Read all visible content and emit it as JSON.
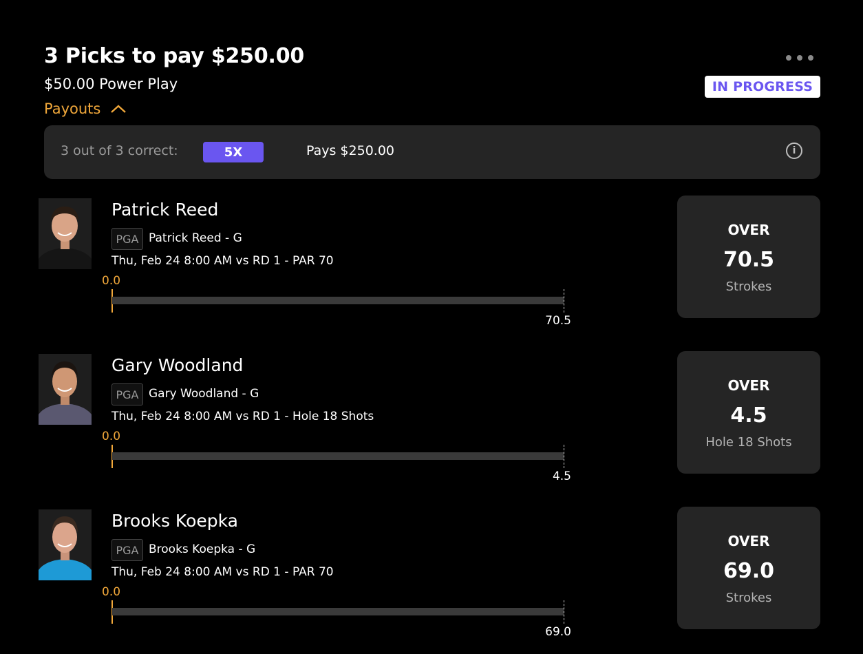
{
  "header": {
    "title": "3 Picks to pay $250.00",
    "subtitle": "$50.00 Power Play",
    "payouts_label": "Payouts",
    "status": "IN PROGRESS",
    "status_color": "#6a56f0",
    "accent_color": "#f0a73a"
  },
  "payout": {
    "condition": "3 out of 3 correct:",
    "multiplier": "5X",
    "pays": "Pays $250.00",
    "info_icon": "info-icon"
  },
  "picks": [
    {
      "player": "Patrick Reed",
      "league": "PGA",
      "desc": "Patrick Reed - G",
      "game": "Thu, Feb 24 8:00 AM  vs RD 1 - PAR 70",
      "current": "0.0",
      "line": "70.5",
      "direction": "OVER",
      "stat": "Strokes",
      "shirt_color": "#1a1a1a"
    },
    {
      "player": "Gary Woodland",
      "league": "PGA",
      "desc": "Gary Woodland - G",
      "game": "Thu, Feb 24 8:00 AM  vs RD 1 - Hole 18 Shots",
      "current": "0.0",
      "line": "4.5",
      "direction": "OVER",
      "stat": "Hole 18 Shots",
      "shirt_color": "#5a5870"
    },
    {
      "player": "Brooks Koepka",
      "league": "PGA",
      "desc": "Brooks Koepka - G",
      "game": "Thu, Feb 24 8:00 AM  vs RD 1 - PAR 70",
      "current": "0.0",
      "line": "69.0",
      "direction": "OVER",
      "stat": "Strokes",
      "shirt_color": "#1e9ad6"
    }
  ]
}
